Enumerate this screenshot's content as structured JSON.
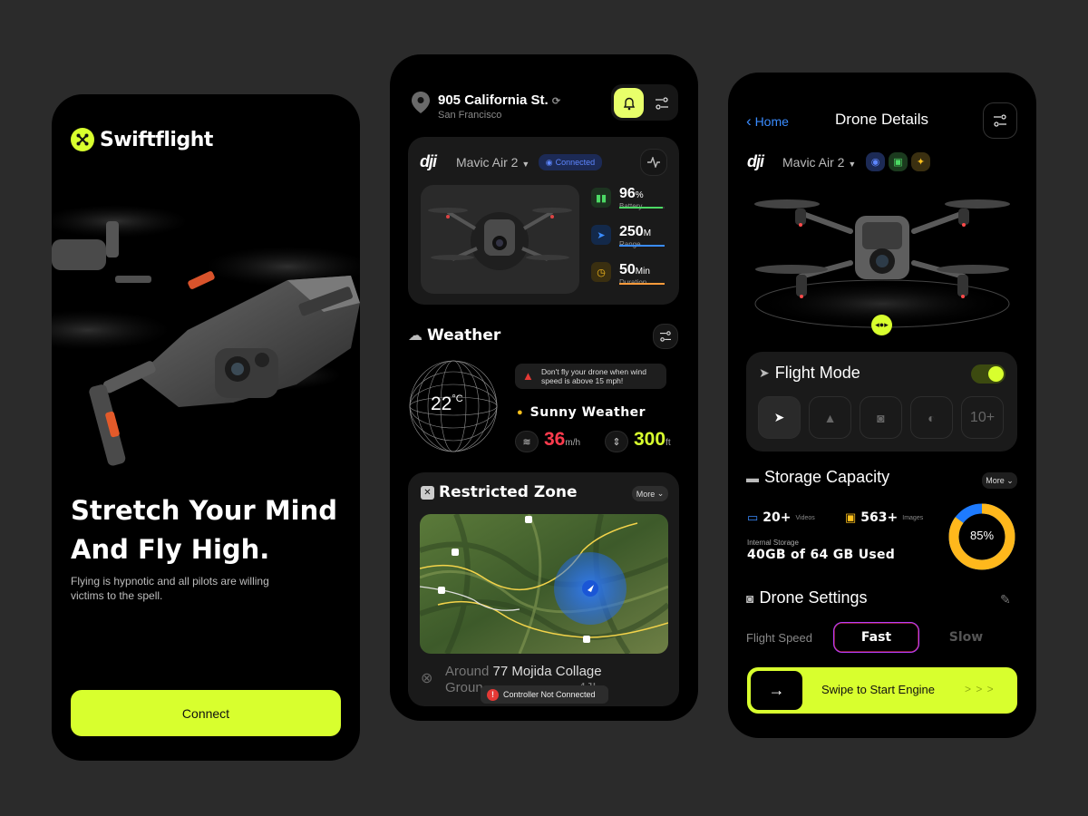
{
  "colors": {
    "accent": "#d8ff2e",
    "background": "#2b2b2b",
    "phone": "#000000",
    "card": "#1a1a1a",
    "warning": "#e53935",
    "speed": "#ff3b4d",
    "storage_used": "#ffb81c",
    "storage_free": "#1e7bff"
  },
  "screen1": {
    "brand": "Swiftflight",
    "brand_icon": "drone-icon",
    "headline_line1": "Stretch Your Mind",
    "headline_line2": "And Fly High.",
    "description": "Flying is hypnotic and all pilots are willing victims to the spell.",
    "connect_label": "Connect"
  },
  "screen2": {
    "address": "905 California St.",
    "city": "San Francisco",
    "drone_brand": "dji",
    "drone_model": "Mavic Air 2",
    "connection_status": "Connected",
    "battery": {
      "value": "96",
      "unit": "%",
      "label": "Battery",
      "level": 0.96
    },
    "range": {
      "value": "250",
      "unit": "M",
      "label": "Range"
    },
    "duration": {
      "value": "50",
      "unit": "Min",
      "label": "Duration"
    },
    "weather_title": "Weather",
    "temperature": "22",
    "temperature_unit": "°C",
    "warning": "Don't fly your drone when wind speed is above 15 mph!",
    "condition": "Sunny Weather",
    "wind_value": "36",
    "wind_unit": "m/h",
    "altitude_value": "300",
    "altitude_unit": "ft",
    "zone_title": "Restricted Zone",
    "more_label": "More",
    "location_prefix": "Around",
    "location_name": "77 Mojida Collage",
    "location_line2_start": "Groun",
    "location_line2_end": "4JL",
    "controller_status": "Controller Not Connected"
  },
  "screen3": {
    "back_label": "Home",
    "title": "Drone Details",
    "drone_brand": "dji",
    "drone_model": "Mavic Air 2",
    "flight_mode_title": "Flight Mode",
    "flight_mode_on": true,
    "modes_more": "10+",
    "storage_title": "Storage Capacity",
    "storage_more": "More",
    "videos_count": "20+",
    "videos_label": "Videos",
    "images_count": "563+",
    "images_label": "Images",
    "internal_label": "Internal Storage",
    "storage_used_text": "40GB of 64 GB Used",
    "storage_percent_label": "85%",
    "storage_percent": 85,
    "settings_title": "Drone Settings",
    "speed_label": "Flight Speed",
    "speed_fast": "Fast",
    "speed_slow": "Slow",
    "swipe_label": "Swipe to Start Engine",
    "swipe_arrow": "→",
    "swipe_chevrons": "> > >"
  }
}
